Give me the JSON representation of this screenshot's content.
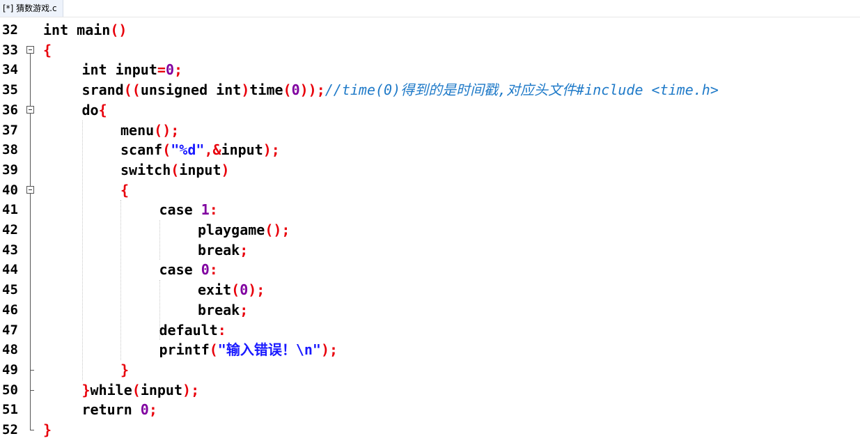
{
  "tab": {
    "label": "[*] 猜数游戏.c"
  },
  "lines": [
    {
      "no": "32",
      "indent": 0,
      "fold": "none",
      "tokens": [
        {
          "t": "int ",
          "c": "kw"
        },
        {
          "t": "main",
          "c": "tx"
        },
        {
          "t": "()",
          "c": "pn"
        }
      ]
    },
    {
      "no": "33",
      "indent": 0,
      "fold": "open",
      "tokens": [
        {
          "t": "{",
          "c": "pn"
        }
      ]
    },
    {
      "no": "34",
      "indent": 1,
      "fold": "body",
      "tokens": [
        {
          "t": "int ",
          "c": "kw"
        },
        {
          "t": "input",
          "c": "tx"
        },
        {
          "t": "=",
          "c": "pn"
        },
        {
          "t": "0",
          "c": "nm"
        },
        {
          "t": ";",
          "c": "pn"
        }
      ]
    },
    {
      "no": "35",
      "indent": 1,
      "fold": "body",
      "tokens": [
        {
          "t": "srand",
          "c": "tx"
        },
        {
          "t": "((",
          "c": "pn"
        },
        {
          "t": "unsigned int",
          "c": "kw"
        },
        {
          "t": ")",
          "c": "pn"
        },
        {
          "t": "time",
          "c": "tx"
        },
        {
          "t": "(",
          "c": "pn"
        },
        {
          "t": "0",
          "c": "nm"
        },
        {
          "t": "));",
          "c": "pn"
        },
        {
          "t": "//time(0)得到的是时间戳,对应头文件#include <time.h>",
          "c": "cm"
        }
      ]
    },
    {
      "no": "36",
      "indent": 1,
      "fold": "open",
      "tokens": [
        {
          "t": "do",
          "c": "kw"
        },
        {
          "t": "{",
          "c": "pn"
        }
      ]
    },
    {
      "no": "37",
      "indent": 2,
      "fold": "body",
      "tokens": [
        {
          "t": "menu",
          "c": "tx"
        },
        {
          "t": "();",
          "c": "pn"
        }
      ]
    },
    {
      "no": "38",
      "indent": 2,
      "fold": "body",
      "tokens": [
        {
          "t": "scanf",
          "c": "tx"
        },
        {
          "t": "(",
          "c": "pn"
        },
        {
          "t": "\"%d\"",
          "c": "st"
        },
        {
          "t": ",&",
          "c": "pn"
        },
        {
          "t": "input",
          "c": "tx"
        },
        {
          "t": ");",
          "c": "pn"
        }
      ]
    },
    {
      "no": "39",
      "indent": 2,
      "fold": "body",
      "tokens": [
        {
          "t": "switch",
          "c": "kw"
        },
        {
          "t": "(",
          "c": "pn"
        },
        {
          "t": "input",
          "c": "tx"
        },
        {
          "t": ")",
          "c": "pn"
        }
      ]
    },
    {
      "no": "40",
      "indent": 2,
      "fold": "open",
      "tokens": [
        {
          "t": "{",
          "c": "pn"
        }
      ]
    },
    {
      "no": "41",
      "indent": 3,
      "fold": "body",
      "tokens": [
        {
          "t": "case ",
          "c": "kw"
        },
        {
          "t": "1",
          "c": "nm"
        },
        {
          "t": ":",
          "c": "pn"
        }
      ]
    },
    {
      "no": "42",
      "indent": 4,
      "fold": "body",
      "tokens": [
        {
          "t": "playgame",
          "c": "tx"
        },
        {
          "t": "();",
          "c": "pn"
        }
      ]
    },
    {
      "no": "43",
      "indent": 4,
      "fold": "body",
      "tokens": [
        {
          "t": "break",
          "c": "kw"
        },
        {
          "t": ";",
          "c": "pn"
        }
      ]
    },
    {
      "no": "44",
      "indent": 3,
      "fold": "body",
      "tokens": [
        {
          "t": "case ",
          "c": "kw"
        },
        {
          "t": "0",
          "c": "nm"
        },
        {
          "t": ":",
          "c": "pn"
        }
      ]
    },
    {
      "no": "45",
      "indent": 4,
      "fold": "body",
      "tokens": [
        {
          "t": "exit",
          "c": "tx"
        },
        {
          "t": "(",
          "c": "pn"
        },
        {
          "t": "0",
          "c": "nm"
        },
        {
          "t": ");",
          "c": "pn"
        }
      ]
    },
    {
      "no": "46",
      "indent": 4,
      "fold": "body",
      "tokens": [
        {
          "t": "break",
          "c": "kw"
        },
        {
          "t": ";",
          "c": "pn"
        }
      ]
    },
    {
      "no": "47",
      "indent": 3,
      "fold": "body",
      "tokens": [
        {
          "t": "default",
          "c": "kw"
        },
        {
          "t": ":",
          "c": "pn"
        }
      ]
    },
    {
      "no": "48",
      "indent": 3,
      "fold": "body",
      "tokens": [
        {
          "t": "printf",
          "c": "tx"
        },
        {
          "t": "(",
          "c": "pn"
        },
        {
          "t": "\"输入错误！\\n\"",
          "c": "st"
        },
        {
          "t": ");",
          "c": "pn"
        }
      ]
    },
    {
      "no": "49",
      "indent": 2,
      "fold": "close",
      "tokens": [
        {
          "t": "}",
          "c": "pn"
        }
      ]
    },
    {
      "no": "50",
      "indent": 1,
      "fold": "close",
      "tokens": [
        {
          "t": "}",
          "c": "pn"
        },
        {
          "t": "while",
          "c": "kw"
        },
        {
          "t": "(",
          "c": "pn"
        },
        {
          "t": "input",
          "c": "tx"
        },
        {
          "t": ");",
          "c": "pn"
        }
      ]
    },
    {
      "no": "51",
      "indent": 1,
      "fold": "body",
      "tokens": [
        {
          "t": "return ",
          "c": "kw"
        },
        {
          "t": "0",
          "c": "nm"
        },
        {
          "t": ";",
          "c": "pn"
        }
      ]
    },
    {
      "no": "52",
      "indent": 0,
      "fold": "end",
      "tokens": [
        {
          "t": "}",
          "c": "pn"
        }
      ]
    }
  ],
  "colors": {
    "keyword": "#000000",
    "punctuation": "#e8000b",
    "number": "#8000a0",
    "string": "#1a1aff",
    "comment": "#1f7ac8"
  }
}
